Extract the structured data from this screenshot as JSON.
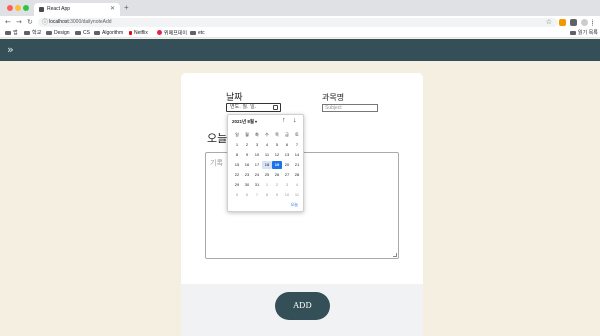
{
  "browser": {
    "tab_title": "React App",
    "tab_close": "✕",
    "new_tab": "+",
    "back": "←",
    "forward": "→",
    "reload": "↻",
    "lock": "ⓘ",
    "url_host": "localhost",
    "url_path": ":3000/dailynoteAdd",
    "bookmark_star": "☆",
    "bookmarks": [
      "앱",
      "학교",
      "Design",
      "CS",
      "Algorithm",
      "Netflix",
      "위메프데이",
      "etc"
    ],
    "reading_list": "읽기 목록"
  },
  "app": {
    "menu_icon": "»",
    "date_label": "날짜",
    "subject_label": "과목명",
    "date_placeholder": "연도. 월. 일.",
    "subject_placeholder": "Subject",
    "today_label": "오늘",
    "record_placeholder": "기록",
    "add_button": "ADD"
  },
  "datepicker": {
    "month_label": "2021년 8월",
    "caret": "▾",
    "prev_icon": "↑",
    "next_icon": "↓",
    "weekdays": [
      "일",
      "월",
      "화",
      "수",
      "목",
      "금",
      "토"
    ],
    "weeks": [
      [
        {
          "d": "1"
        },
        {
          "d": "2"
        },
        {
          "d": "3"
        },
        {
          "d": "4"
        },
        {
          "d": "5"
        },
        {
          "d": "6"
        },
        {
          "d": "7"
        }
      ],
      [
        {
          "d": "8"
        },
        {
          "d": "9"
        },
        {
          "d": "10"
        },
        {
          "d": "11"
        },
        {
          "d": "12"
        },
        {
          "d": "13"
        },
        {
          "d": "14"
        }
      ],
      [
        {
          "d": "15"
        },
        {
          "d": "16"
        },
        {
          "d": "17"
        },
        {
          "d": "18",
          "s": "hover"
        },
        {
          "d": "19",
          "s": "selected"
        },
        {
          "d": "20"
        },
        {
          "d": "21"
        }
      ],
      [
        {
          "d": "22"
        },
        {
          "d": "23"
        },
        {
          "d": "24"
        },
        {
          "d": "25"
        },
        {
          "d": "26"
        },
        {
          "d": "27"
        },
        {
          "d": "28"
        }
      ],
      [
        {
          "d": "29"
        },
        {
          "d": "30"
        },
        {
          "d": "31"
        },
        {
          "d": "1",
          "s": "muted"
        },
        {
          "d": "2",
          "s": "muted"
        },
        {
          "d": "3",
          "s": "muted"
        },
        {
          "d": "4",
          "s": "muted"
        }
      ],
      [
        {
          "d": "5",
          "s": "muted"
        },
        {
          "d": "6",
          "s": "muted"
        },
        {
          "d": "7",
          "s": "muted"
        },
        {
          "d": "8",
          "s": "muted"
        },
        {
          "d": "9",
          "s": "muted"
        },
        {
          "d": "10",
          "s": "muted"
        },
        {
          "d": "11",
          "s": "muted"
        }
      ]
    ],
    "today_button": "오늘"
  },
  "colors": {
    "header": "#344f57",
    "background": "#f4efe0",
    "selected_day": "#1a73e8"
  }
}
